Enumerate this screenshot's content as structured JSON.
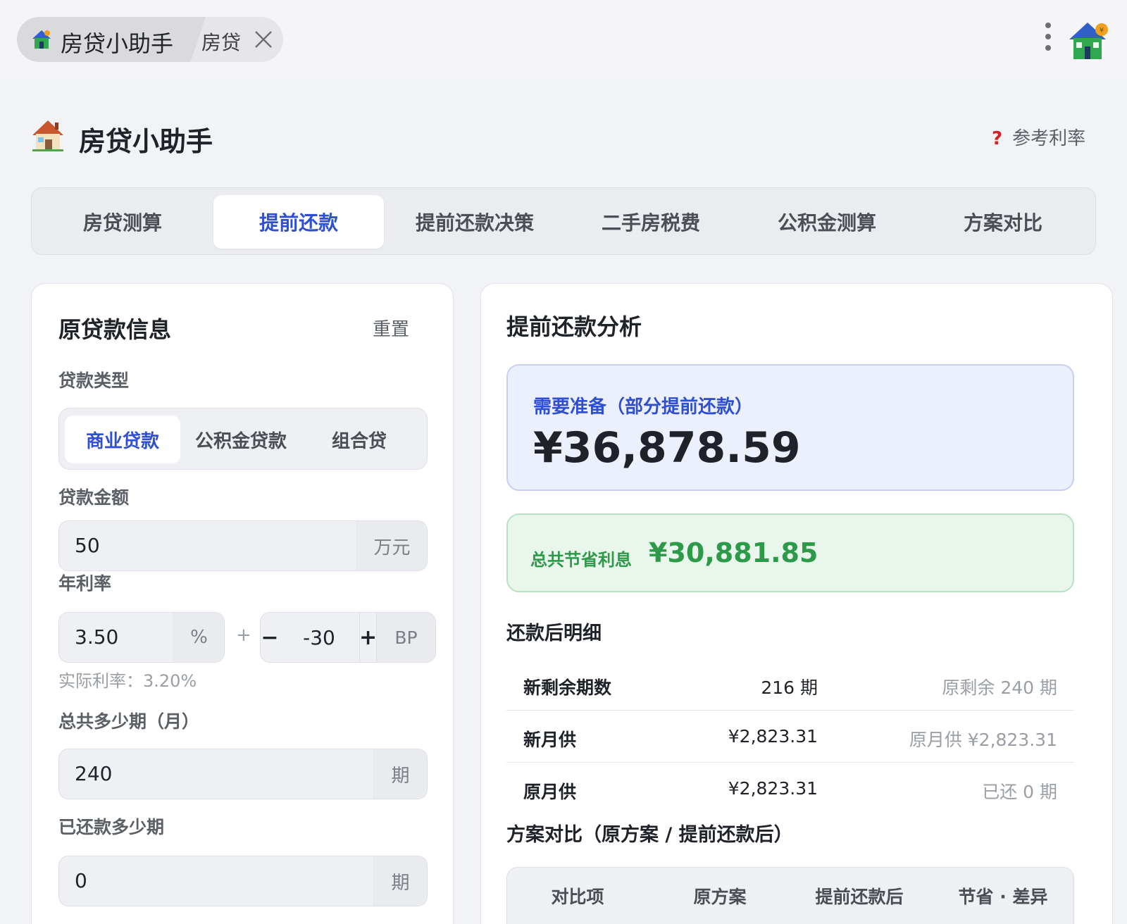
{
  "top_bar": {
    "tab_app_title": "房贷小助手",
    "tab2_label": "房贷"
  },
  "header": {
    "title": "房贷小助手",
    "rate_link": "参考利率",
    "rate_mark": "?"
  },
  "tabs": [
    {
      "label": "房贷测算",
      "active": false
    },
    {
      "label": "提前还款",
      "active": true
    },
    {
      "label": "提前还款决策",
      "active": false
    },
    {
      "label": "二手房税费",
      "active": false
    },
    {
      "label": "公积金测算",
      "active": false
    },
    {
      "label": "方案对比",
      "active": false
    }
  ],
  "loan_form": {
    "title": "原贷款信息",
    "reset": "重置",
    "loan_type_label": "贷款类型",
    "loan_types": [
      "商业贷款",
      "公积金贷款",
      "组合贷"
    ],
    "selected_loan_type": "商业贷款",
    "amount_label": "贷款金额",
    "amount_value": "50",
    "amount_unit": "万元",
    "rate_label": "年利率",
    "rate_value": "3.50",
    "rate_unit": "%",
    "plus_sign": "+",
    "bp_minus": "−",
    "bp_value": "-30",
    "bp_plus": "+",
    "bp_unit": "BP",
    "actual_rate": "实际利率：3.20%",
    "periods_label": "总共多少期（月）",
    "periods_value": "240",
    "periods_unit": "期",
    "paid_label": "已还款多少期",
    "paid_value": "0",
    "paid_unit": "期"
  },
  "analysis": {
    "title": "提前还款分析",
    "need_label": "需要准备（部分提前还款）",
    "need_value": "¥36,878.59",
    "save_label": "总共节省利息",
    "save_value": "¥30,881.85",
    "detail_title": "还款后明细",
    "details": [
      {
        "name": "新剩余期数",
        "value": "216 期",
        "note": "原剩余 240 期"
      },
      {
        "name": "新月供",
        "value": "¥2,823.31",
        "note": "原月供 ¥2,823.31"
      },
      {
        "name": "原月供",
        "value": "¥2,823.31",
        "note": "已还 0 期"
      }
    ],
    "compare_title": "方案对比（原方案 / 提前还款后）",
    "compare_columns": [
      "对比项",
      "原方案",
      "提前还款后",
      "节省 · 差异"
    ]
  },
  "colors": {
    "accent": "#2f4fd3",
    "save_green": "#2d9a49",
    "background": "#f2f3f6"
  },
  "icons": {
    "tab_app": "house-icon",
    "close": "close-icon",
    "more": "kebab-menu-icon",
    "corner": "house-icon",
    "header": "house-emoji-icon",
    "rate_help": "question-icon"
  }
}
